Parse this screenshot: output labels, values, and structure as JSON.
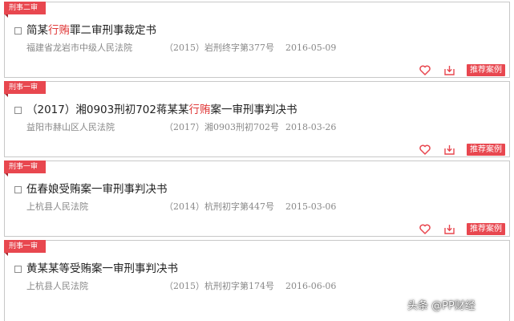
{
  "cases": [
    {
      "tag": "刑事二审",
      "title_pre": "简某",
      "title_hl": "行贿",
      "title_post": "罪二审刑事裁定书",
      "court": "福建省龙岩市中级人民法院",
      "case_no": "（2015）岩刑终字第377号",
      "date": "2016-05-09",
      "recommend_label": "推荐案例"
    },
    {
      "tag": "刑事一审",
      "title_pre": "（2017）湘0903刑初702蒋某某",
      "title_hl": "行贿",
      "title_post": "案一审刑事判决书",
      "court": "益阳市赫山区人民法院",
      "case_no": "（2017）湘0903刑初702号",
      "date": "2018-03-26",
      "recommend_label": "推荐案例"
    },
    {
      "tag": "刑事一审",
      "title_pre": "伍春娘受贿案一审刑事判决书",
      "title_hl": "",
      "title_post": "",
      "court": "上杭县人民法院",
      "case_no": "（2014）杭刑初字第447号",
      "date": "2015-03-06",
      "recommend_label": "推荐案例"
    },
    {
      "tag": "刑事一审",
      "title_pre": "黄某某等受贿案一审刑事判决书",
      "title_hl": "",
      "title_post": "",
      "court": "上杭县人民法院",
      "case_no": "（2015）杭刑初字第174号",
      "date": "2016-06-06"
    }
  ],
  "watermark": "头条 @PP财经",
  "colors": {
    "accent": "#e8474f",
    "highlight": "#e03c3c",
    "meta_text": "#888888",
    "border": "#c8c8c8"
  },
  "icons": {
    "favorite": "heart-icon",
    "download": "download-icon"
  }
}
